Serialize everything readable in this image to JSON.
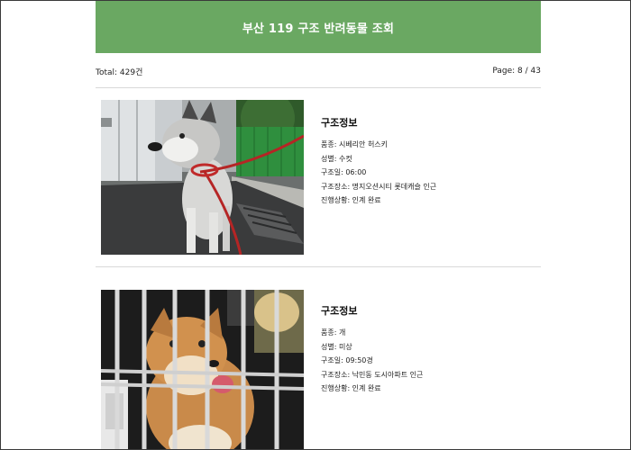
{
  "header": {
    "title": "부산 119 구조 반려동물 조회",
    "color": "#6aa862"
  },
  "summary": {
    "total": "Total: 429건",
    "page": "Page: 8 / 43"
  },
  "records": [
    {
      "section_title": "구조정보",
      "breed": "품종: 시베리안 허스키",
      "sex": "성별: 수컷",
      "rescue_time": "구조일: 06:00",
      "location": "구조장소: 명지오션시티 롯데캐슬 인근",
      "status": "진행상황: 인계 완료",
      "photo_subject": "siberian-husky-on-leash"
    },
    {
      "section_title": "구조정보",
      "breed": "품종: 개",
      "sex": "성별: 미상",
      "rescue_time": "구조일: 09:50경",
      "location": "구조장소: 낙민동 도시아파트 인근",
      "status": "진행상황: 인계 완료",
      "photo_subject": "dog-in-cage"
    }
  ]
}
